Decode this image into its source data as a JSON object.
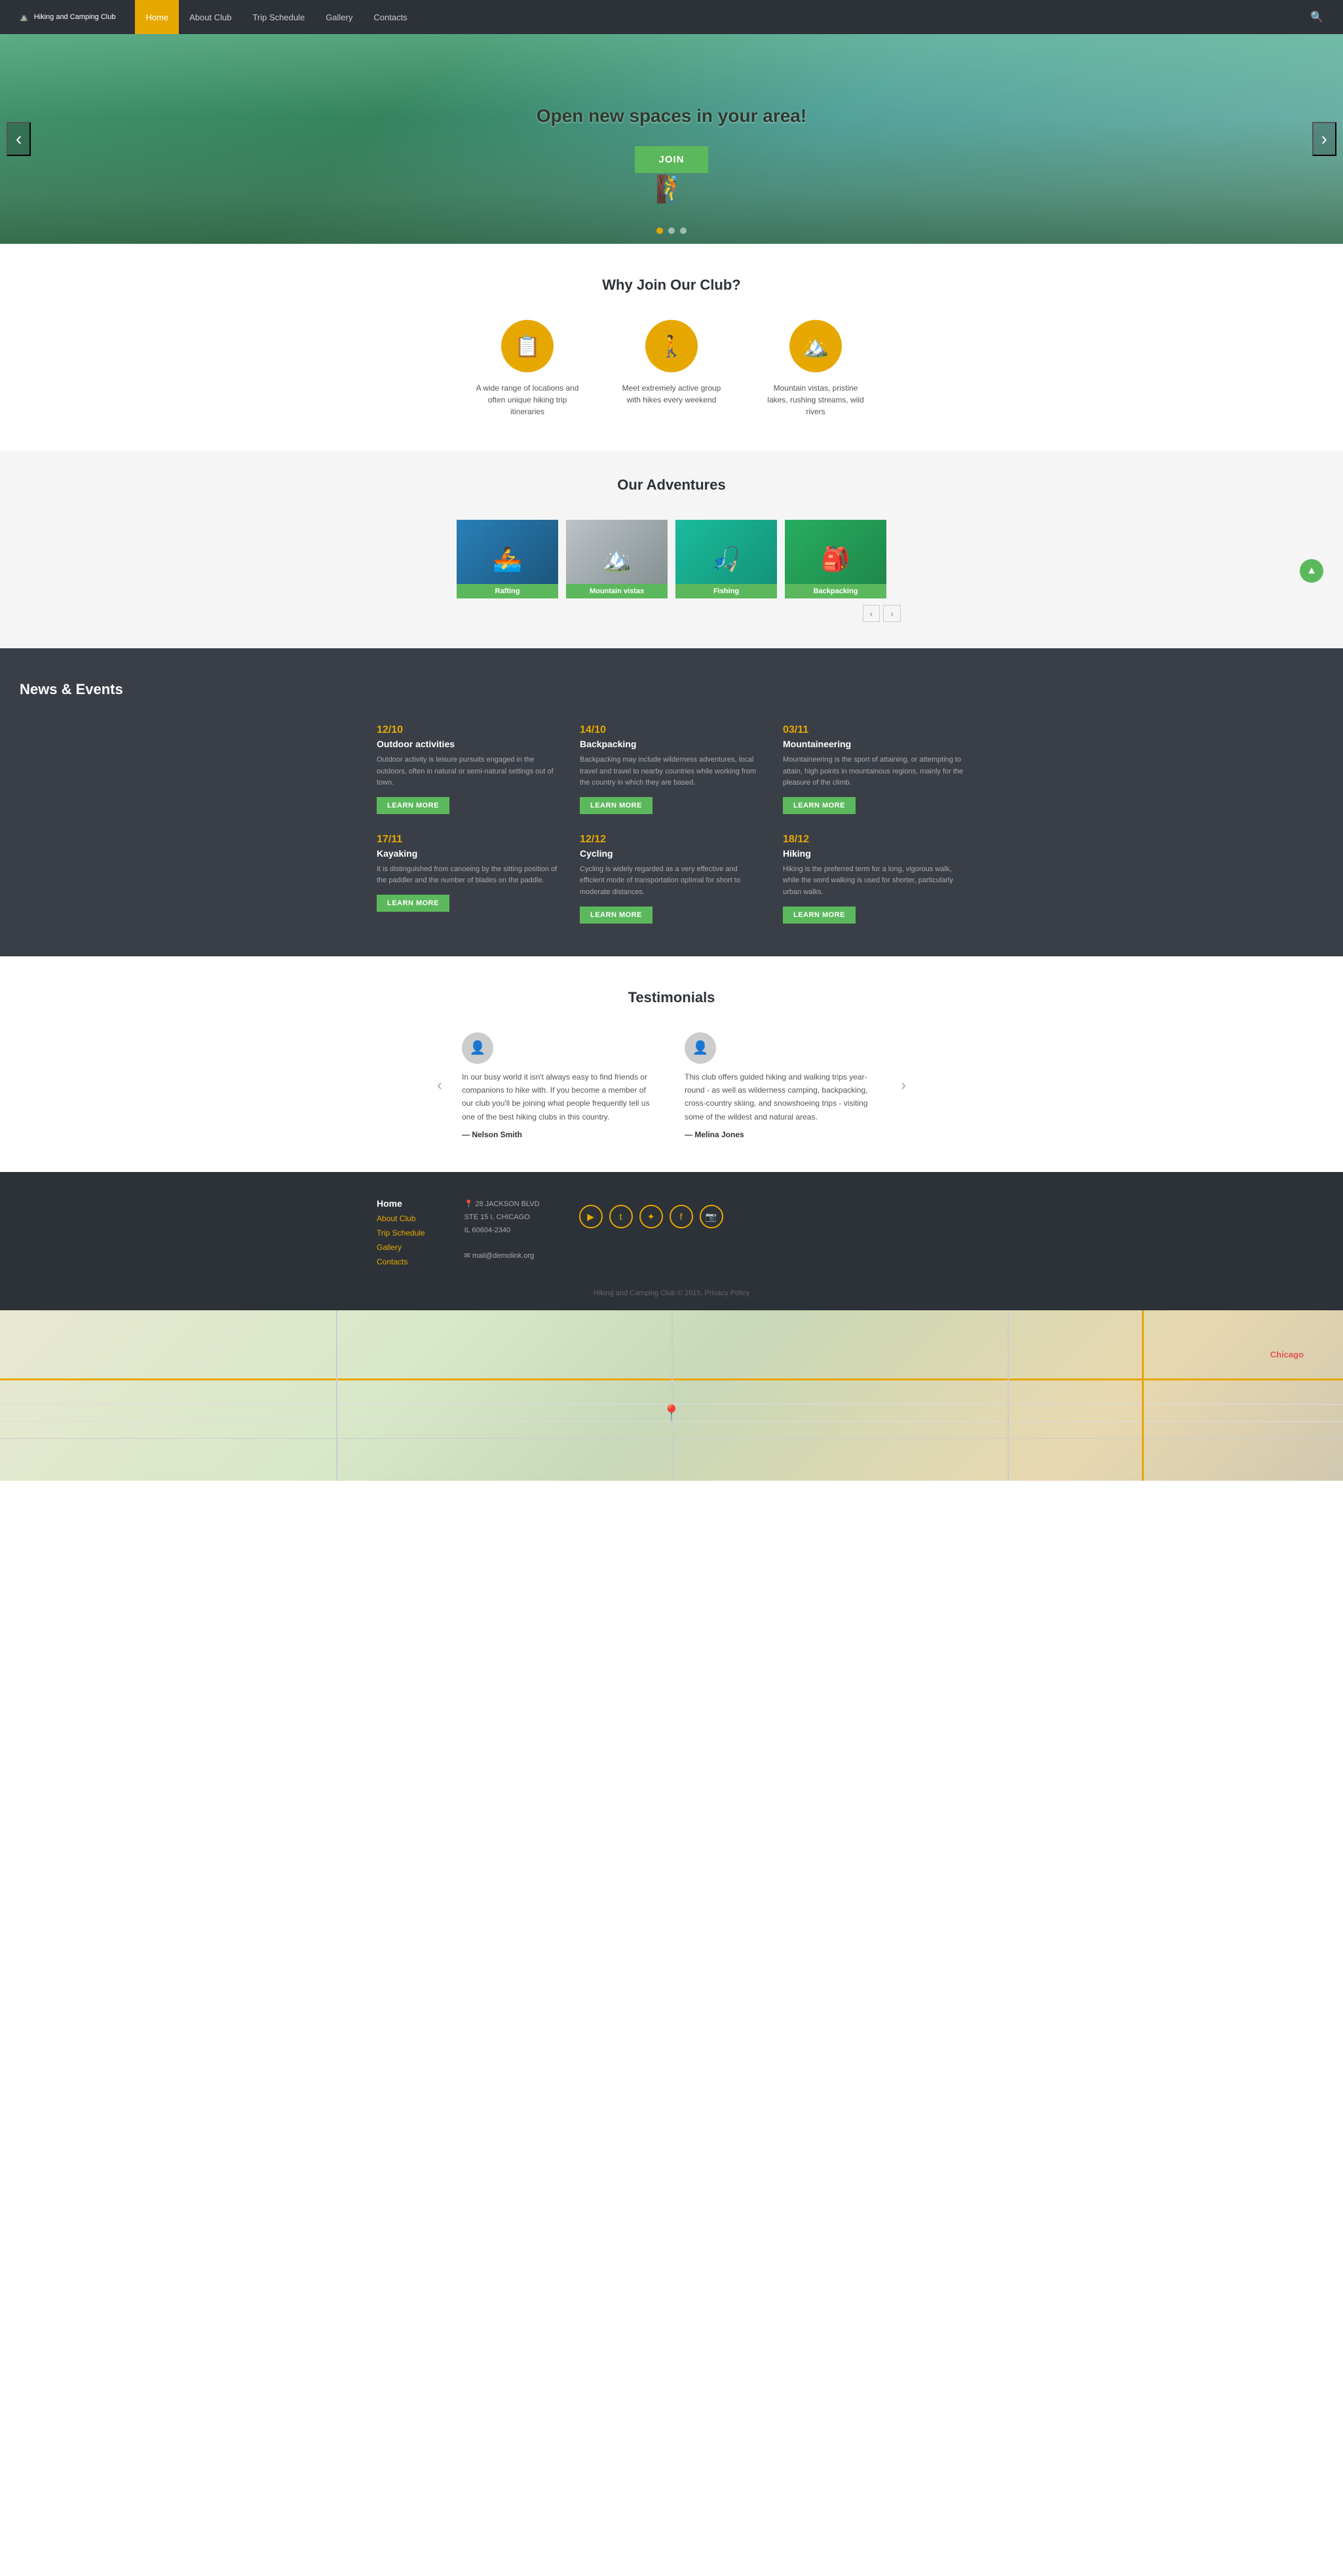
{
  "nav": {
    "logo_text": "Hiking and Camping Club",
    "logo_icon": "⛰️",
    "links": [
      {
        "label": "Home",
        "active": true
      },
      {
        "label": "About Club",
        "active": false
      },
      {
        "label": "Trip Schedule",
        "active": false
      },
      {
        "label": "Gallery",
        "active": false
      },
      {
        "label": "Contacts",
        "active": false
      }
    ],
    "search_icon": "🔍"
  },
  "hero": {
    "title": "Open new spaces in your area!",
    "join_btn": "JOIN",
    "dots": [
      true,
      false,
      false
    ],
    "prev_icon": "‹",
    "next_icon": "›",
    "figure_icon": "🧗"
  },
  "why_join": {
    "section_title": "Why Join Our Club?",
    "cards": [
      {
        "icon": "📋",
        "text": "A wide range of locations and often unique hiking trip itineraries"
      },
      {
        "icon": "🚶",
        "text": "Meet extremely active group with hikes every weekend"
      },
      {
        "icon": "🏔️",
        "text": "Mountain vistas, pristine lakes, rushing streams, wild rivers"
      }
    ]
  },
  "adventures": {
    "section_title": "Our Adventures",
    "items": [
      {
        "label": "Rafting",
        "emoji": "🚣",
        "color_class": "adv-rafting"
      },
      {
        "label": "Mountain vistas",
        "emoji": "🏔️",
        "color_class": "adv-mountain"
      },
      {
        "label": "Fishing",
        "emoji": "🎣",
        "color_class": "adv-fishing"
      },
      {
        "label": "Backpacking",
        "emoji": "🎒",
        "color_class": "adv-backpacking"
      }
    ],
    "prev_icon": "‹",
    "next_icon": "›",
    "scroll_top_icon": "▲"
  },
  "news": {
    "section_title": "News & Events",
    "items": [
      {
        "date": "12/10",
        "title": "Outdoor activities",
        "text": "Outdoor activity is leisure pursuits engaged in the outdoors, often in natural or semi-natural settings out of town.",
        "btn": "LEARN MORE"
      },
      {
        "date": "14/10",
        "title": "Backpacking",
        "text": "Backpacking may include wilderness adventures, local travel and travel to nearby countries while working from the country in which they are based.",
        "btn": "LEARN MORE"
      },
      {
        "date": "03/11",
        "title": "Mountaineering",
        "text": "Mountaineering is the sport of attaining, or attempting to attain, high points in mountainous regions, mainly for the pleasure of the climb.",
        "btn": "LEARN MORE"
      },
      {
        "date": "17/11",
        "title": "Kayaking",
        "text": "It is distinguished from canoeing by the sitting position of the paddler and the number of blades on the paddle.",
        "btn": "LEARN MORE"
      },
      {
        "date": "12/12",
        "title": "Cycling",
        "text": "Cycling is widely regarded as a very effective and efficient mode of transportation optimal for short to moderate distances.",
        "btn": "LEARN MORE"
      },
      {
        "date": "18/12",
        "title": "Hiking",
        "text": "Hiking is the preferred term for a long, vigorous walk, while the word walking is used for shorter, particularly urban walks.",
        "btn": "LEARN MORE"
      }
    ]
  },
  "testimonials": {
    "section_title": "Testimonials",
    "prev_icon": "‹",
    "next_icon": "›",
    "items": [
      {
        "avatar": "👤",
        "text": "In our busy world it isn't always easy to find friends or companions to hike with. If you become a member of our club you'll be joining what people frequently tell us one of the best hiking clubs in this country.",
        "author": "— Nelson Smith"
      },
      {
        "avatar": "👤",
        "text": "This club offers guided hiking and walking trips year-round - as well as wilderness camping, backpacking, cross-country skiing, and snowshoeing trips - visiting some of the wildest and natural areas.",
        "author": "— Melina Jones"
      }
    ]
  },
  "footer": {
    "links": [
      {
        "label": "Home"
      },
      {
        "label": "About Club"
      },
      {
        "label": "Trip Schedule"
      },
      {
        "label": "Gallery"
      },
      {
        "label": "Contacts"
      }
    ],
    "address_icon": "📍",
    "address": "28 JACKSON BLVD\nSTE 15 I, CHICAGO\nIL 60604-2340",
    "email_icon": "✉",
    "email": "mail@demolink.org",
    "social_icons": [
      "▶",
      "t",
      "✦",
      "f",
      "📷"
    ],
    "copyright": "Hiking and Camping Club © 2015. Privacy Policy"
  },
  "map": {
    "city_label": "Chicago",
    "pin_icon": "📍"
  }
}
